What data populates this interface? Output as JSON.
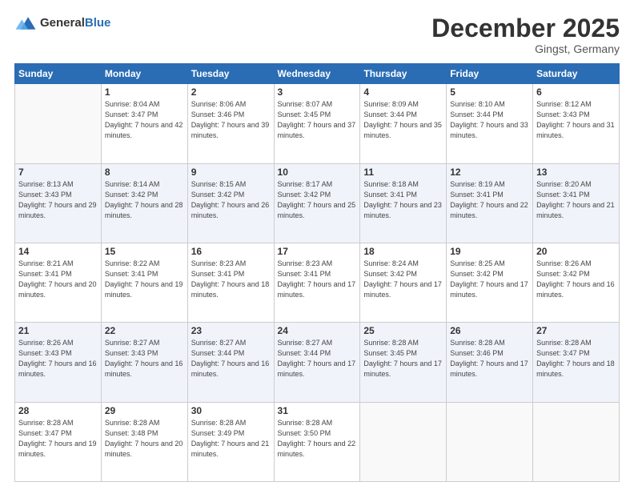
{
  "header": {
    "logo_general": "General",
    "logo_blue": "Blue",
    "month_title": "December 2025",
    "location": "Gingst, Germany"
  },
  "days_of_week": [
    "Sunday",
    "Monday",
    "Tuesday",
    "Wednesday",
    "Thursday",
    "Friday",
    "Saturday"
  ],
  "weeks": [
    [
      {
        "day": "",
        "sunrise": "",
        "sunset": "",
        "daylight": ""
      },
      {
        "day": "1",
        "sunrise": "Sunrise: 8:04 AM",
        "sunset": "Sunset: 3:47 PM",
        "daylight": "Daylight: 7 hours and 42 minutes."
      },
      {
        "day": "2",
        "sunrise": "Sunrise: 8:06 AM",
        "sunset": "Sunset: 3:46 PM",
        "daylight": "Daylight: 7 hours and 39 minutes."
      },
      {
        "day": "3",
        "sunrise": "Sunrise: 8:07 AM",
        "sunset": "Sunset: 3:45 PM",
        "daylight": "Daylight: 7 hours and 37 minutes."
      },
      {
        "day": "4",
        "sunrise": "Sunrise: 8:09 AM",
        "sunset": "Sunset: 3:44 PM",
        "daylight": "Daylight: 7 hours and 35 minutes."
      },
      {
        "day": "5",
        "sunrise": "Sunrise: 8:10 AM",
        "sunset": "Sunset: 3:44 PM",
        "daylight": "Daylight: 7 hours and 33 minutes."
      },
      {
        "day": "6",
        "sunrise": "Sunrise: 8:12 AM",
        "sunset": "Sunset: 3:43 PM",
        "daylight": "Daylight: 7 hours and 31 minutes."
      }
    ],
    [
      {
        "day": "7",
        "sunrise": "Sunrise: 8:13 AM",
        "sunset": "Sunset: 3:43 PM",
        "daylight": "Daylight: 7 hours and 29 minutes."
      },
      {
        "day": "8",
        "sunrise": "Sunrise: 8:14 AM",
        "sunset": "Sunset: 3:42 PM",
        "daylight": "Daylight: 7 hours and 28 minutes."
      },
      {
        "day": "9",
        "sunrise": "Sunrise: 8:15 AM",
        "sunset": "Sunset: 3:42 PM",
        "daylight": "Daylight: 7 hours and 26 minutes."
      },
      {
        "day": "10",
        "sunrise": "Sunrise: 8:17 AM",
        "sunset": "Sunset: 3:42 PM",
        "daylight": "Daylight: 7 hours and 25 minutes."
      },
      {
        "day": "11",
        "sunrise": "Sunrise: 8:18 AM",
        "sunset": "Sunset: 3:41 PM",
        "daylight": "Daylight: 7 hours and 23 minutes."
      },
      {
        "day": "12",
        "sunrise": "Sunrise: 8:19 AM",
        "sunset": "Sunset: 3:41 PM",
        "daylight": "Daylight: 7 hours and 22 minutes."
      },
      {
        "day": "13",
        "sunrise": "Sunrise: 8:20 AM",
        "sunset": "Sunset: 3:41 PM",
        "daylight": "Daylight: 7 hours and 21 minutes."
      }
    ],
    [
      {
        "day": "14",
        "sunrise": "Sunrise: 8:21 AM",
        "sunset": "Sunset: 3:41 PM",
        "daylight": "Daylight: 7 hours and 20 minutes."
      },
      {
        "day": "15",
        "sunrise": "Sunrise: 8:22 AM",
        "sunset": "Sunset: 3:41 PM",
        "daylight": "Daylight: 7 hours and 19 minutes."
      },
      {
        "day": "16",
        "sunrise": "Sunrise: 8:23 AM",
        "sunset": "Sunset: 3:41 PM",
        "daylight": "Daylight: 7 hours and 18 minutes."
      },
      {
        "day": "17",
        "sunrise": "Sunrise: 8:23 AM",
        "sunset": "Sunset: 3:41 PM",
        "daylight": "Daylight: 7 hours and 17 minutes."
      },
      {
        "day": "18",
        "sunrise": "Sunrise: 8:24 AM",
        "sunset": "Sunset: 3:42 PM",
        "daylight": "Daylight: 7 hours and 17 minutes."
      },
      {
        "day": "19",
        "sunrise": "Sunrise: 8:25 AM",
        "sunset": "Sunset: 3:42 PM",
        "daylight": "Daylight: 7 hours and 17 minutes."
      },
      {
        "day": "20",
        "sunrise": "Sunrise: 8:26 AM",
        "sunset": "Sunset: 3:42 PM",
        "daylight": "Daylight: 7 hours and 16 minutes."
      }
    ],
    [
      {
        "day": "21",
        "sunrise": "Sunrise: 8:26 AM",
        "sunset": "Sunset: 3:43 PM",
        "daylight": "Daylight: 7 hours and 16 minutes."
      },
      {
        "day": "22",
        "sunrise": "Sunrise: 8:27 AM",
        "sunset": "Sunset: 3:43 PM",
        "daylight": "Daylight: 7 hours and 16 minutes."
      },
      {
        "day": "23",
        "sunrise": "Sunrise: 8:27 AM",
        "sunset": "Sunset: 3:44 PM",
        "daylight": "Daylight: 7 hours and 16 minutes."
      },
      {
        "day": "24",
        "sunrise": "Sunrise: 8:27 AM",
        "sunset": "Sunset: 3:44 PM",
        "daylight": "Daylight: 7 hours and 17 minutes."
      },
      {
        "day": "25",
        "sunrise": "Sunrise: 8:28 AM",
        "sunset": "Sunset: 3:45 PM",
        "daylight": "Daylight: 7 hours and 17 minutes."
      },
      {
        "day": "26",
        "sunrise": "Sunrise: 8:28 AM",
        "sunset": "Sunset: 3:46 PM",
        "daylight": "Daylight: 7 hours and 17 minutes."
      },
      {
        "day": "27",
        "sunrise": "Sunrise: 8:28 AM",
        "sunset": "Sunset: 3:47 PM",
        "daylight": "Daylight: 7 hours and 18 minutes."
      }
    ],
    [
      {
        "day": "28",
        "sunrise": "Sunrise: 8:28 AM",
        "sunset": "Sunset: 3:47 PM",
        "daylight": "Daylight: 7 hours and 19 minutes."
      },
      {
        "day": "29",
        "sunrise": "Sunrise: 8:28 AM",
        "sunset": "Sunset: 3:48 PM",
        "daylight": "Daylight: 7 hours and 20 minutes."
      },
      {
        "day": "30",
        "sunrise": "Sunrise: 8:28 AM",
        "sunset": "Sunset: 3:49 PM",
        "daylight": "Daylight: 7 hours and 21 minutes."
      },
      {
        "day": "31",
        "sunrise": "Sunrise: 8:28 AM",
        "sunset": "Sunset: 3:50 PM",
        "daylight": "Daylight: 7 hours and 22 minutes."
      },
      {
        "day": "",
        "sunrise": "",
        "sunset": "",
        "daylight": ""
      },
      {
        "day": "",
        "sunrise": "",
        "sunset": "",
        "daylight": ""
      },
      {
        "day": "",
        "sunrise": "",
        "sunset": "",
        "daylight": ""
      }
    ]
  ]
}
